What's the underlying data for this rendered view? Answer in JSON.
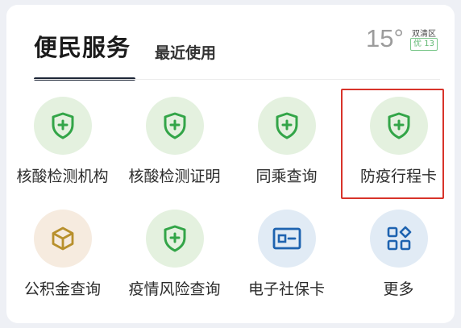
{
  "header": {
    "title": "便民服务",
    "recent_tab": "最近使用"
  },
  "weather": {
    "temperature": "15°",
    "district": "双清区",
    "aqi": "优 13"
  },
  "services": [
    {
      "label": "核酸检测机构",
      "icon": "shield-plus-icon"
    },
    {
      "label": "核酸检测证明",
      "icon": "shield-plus-icon"
    },
    {
      "label": "同乘查询",
      "icon": "shield-plus-icon"
    },
    {
      "label": "防疫行程卡",
      "icon": "shield-plus-icon"
    },
    {
      "label": "公积金查询",
      "icon": "box-icon"
    },
    {
      "label": "疫情风险查询",
      "icon": "shield-plus-icon"
    },
    {
      "label": "电子社保卡",
      "icon": "id-card-icon"
    },
    {
      "label": "更多",
      "icon": "grid-more-icon"
    }
  ],
  "colors": {
    "green": "#33a548",
    "green_bg": "#e4f1df",
    "gold": "#b8902c",
    "gold_bg": "#f6ebdf",
    "blue": "#1e63b0",
    "blue_bg": "#e1ebf5",
    "highlight": "#d8332a"
  }
}
